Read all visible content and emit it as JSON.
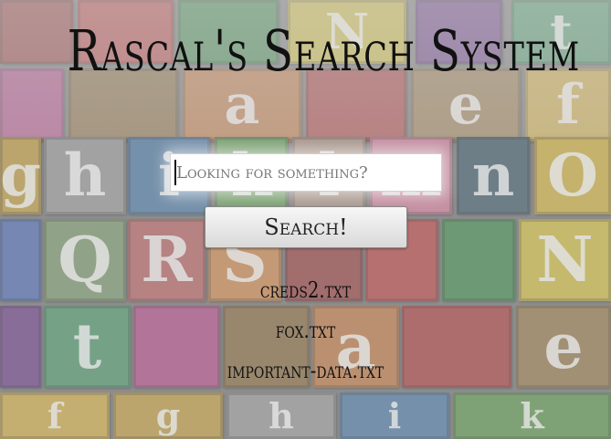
{
  "page": {
    "title": "Rascal's Search System"
  },
  "search": {
    "placeholder": "Looking for something?",
    "button_label": "Search!"
  },
  "results": [
    "creds2.txt",
    "fox.txt",
    "important-data.txt"
  ],
  "background": {
    "tiles": [
      {
        "glyph": "",
        "color": "#8a2a2a"
      },
      {
        "glyph": "",
        "color": "#b03030"
      },
      {
        "glyph": "",
        "color": "#2a7a3a"
      },
      {
        "glyph": "N",
        "color": "#c9b52a"
      },
      {
        "glyph": "",
        "color": "#5b2a7a"
      },
      {
        "glyph": "t",
        "color": "#3a8a5a"
      },
      {
        "glyph": "",
        "color": "#a83a7a"
      },
      {
        "glyph": "",
        "color": "#7a5a2a"
      },
      {
        "glyph": "a",
        "color": "#b86a30"
      },
      {
        "glyph": "",
        "color": "#a02a2a"
      },
      {
        "glyph": "e",
        "color": "#8a6a3a"
      },
      {
        "glyph": "f",
        "color": "#c8a030"
      },
      {
        "glyph": "g",
        "color": "#b8902a"
      },
      {
        "glyph": "h",
        "color": "#8a8a8a"
      },
      {
        "glyph": "i",
        "color": "#3a6a9a"
      },
      {
        "glyph": "k",
        "color": "#4a8a3a"
      },
      {
        "glyph": "l",
        "color": "#9a7a6a"
      },
      {
        "glyph": "m",
        "color": "#c86a8a"
      },
      {
        "glyph": "n",
        "color": "#2a4a5a"
      },
      {
        "glyph": "O",
        "color": "#c8a82a"
      },
      {
        "glyph": "",
        "color": "#3a5aa8"
      },
      {
        "glyph": "Q",
        "color": "#6a8a5a"
      },
      {
        "glyph": "R",
        "color": "#b05050"
      },
      {
        "glyph": "S",
        "color": "#c87a3a"
      }
    ]
  }
}
